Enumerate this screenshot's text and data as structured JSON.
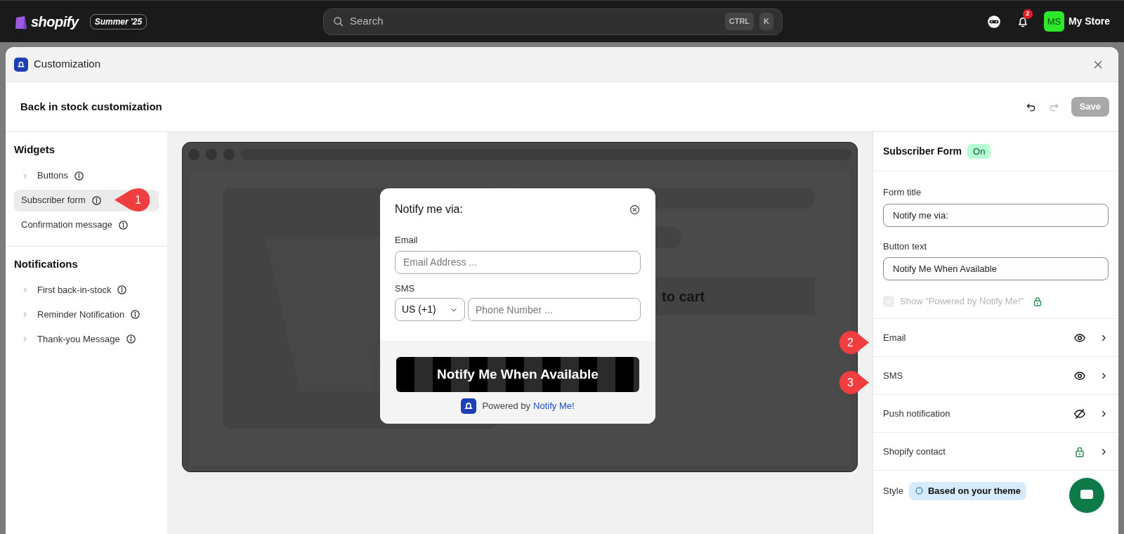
{
  "topbar": {
    "brand": "shopify",
    "edition_badge": "Summer '25",
    "search": {
      "placeholder": "Search",
      "keys": [
        "CTRL",
        "K"
      ]
    },
    "notification_count": "2",
    "avatar_initials": "MS",
    "store_name": "My Store"
  },
  "window": {
    "title": "Customization"
  },
  "header": {
    "title": "Back in stock customization",
    "save_label": "Save",
    "save_disabled": true,
    "redo_disabled": true
  },
  "sidebar": {
    "sections": [
      {
        "title": "Widgets",
        "items": [
          {
            "label": "Buttons",
            "expandable": true,
            "selected": false
          },
          {
            "label": "Subscriber form",
            "expandable": false,
            "selected": true
          },
          {
            "label": "Confirmation message",
            "expandable": false,
            "selected": false
          }
        ]
      },
      {
        "title": "Notifications",
        "items": [
          {
            "label": "First back-in-stock",
            "expandable": true,
            "selected": false
          },
          {
            "label": "Reminder Notification",
            "expandable": true,
            "selected": false
          },
          {
            "label": "Thank-you Message",
            "expandable": true,
            "selected": false
          }
        ]
      }
    ]
  },
  "preview": {
    "store_button_text": "to cart",
    "popup": {
      "title": "Notify me via:",
      "email_label": "Email",
      "email_placeholder": "Email Address ...",
      "sms_label": "SMS",
      "country_value": "US (+1)",
      "phone_placeholder": "Phone Number ...",
      "button_text": "Notify Me When Available",
      "powered_by": "Powered by",
      "powered_link": "Notify Me!"
    }
  },
  "settings": {
    "title": "Subscriber Form",
    "status_badge": "On",
    "form_title_label": "Form title",
    "form_title_value": "Notify me via:",
    "button_text_label": "Button text",
    "button_text_value": "Notify Me When Available",
    "powered_checkbox": {
      "label": "Show \"Powered by Notify Me!\"",
      "checked": true,
      "disabled": true,
      "locked": true
    },
    "channels": [
      {
        "label": "Email",
        "kind": "visible"
      },
      {
        "label": "SMS",
        "kind": "visible"
      },
      {
        "label": "Push notification",
        "kind": "hidden"
      },
      {
        "label": "Shopify contact",
        "kind": "locked"
      }
    ],
    "style_label": "Style",
    "style_value": "Based on your theme"
  },
  "annotations": [
    {
      "number": "1"
    },
    {
      "number": "2"
    },
    {
      "number": "3"
    }
  ]
}
